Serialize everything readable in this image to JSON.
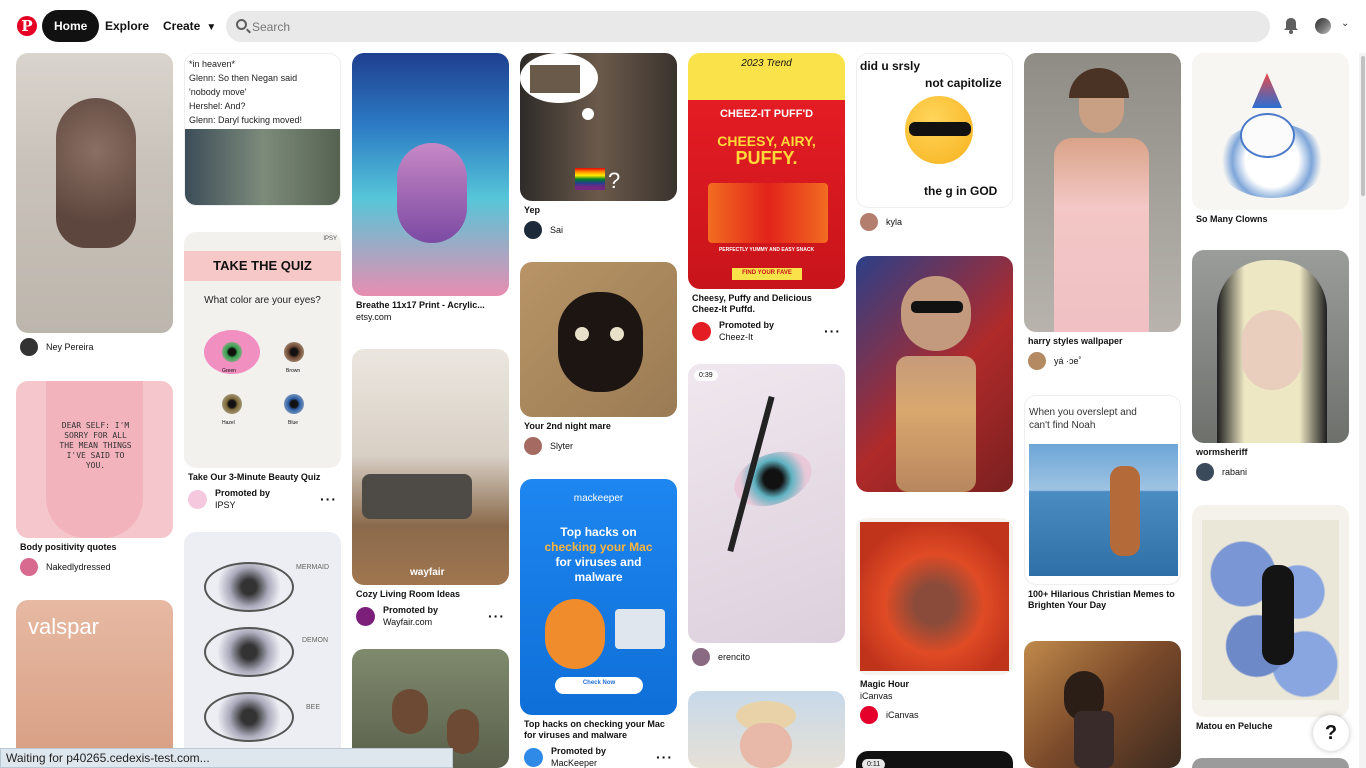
{
  "header": {
    "logo": "P",
    "nav": {
      "home": "Home",
      "explore": "Explore",
      "create": "Create"
    },
    "search": {
      "placeholder": "Search"
    }
  },
  "pins": [
    {
      "author": "Ney Pereira"
    },
    {
      "title": "Body positivity quotes",
      "author": "Nakedlydressed",
      "image_text": "DEAR SELF: I'M SORRY FOR ALL THE MEAN THINGS I'VE SAID TO YOU."
    },
    {
      "image_text": "valspar"
    },
    {
      "image_text": [
        "*in heaven*",
        "Glenn: So then Negan said",
        "'nobody move'",
        "Hershel: And?",
        "Glenn: Daryl fucking moved!"
      ]
    },
    {
      "title": "Take Our 3-Minute Beauty Quiz",
      "promoted": "Promoted by",
      "author": "IPSY",
      "image_text": {
        "brand": "IPSY",
        "banner": "TAKE THE QUIZ",
        "question": "What color are your eyes?",
        "eyes": [
          "Green",
          "Brown",
          "Hazel",
          "Blue"
        ]
      }
    },
    {
      "image_text": [
        "MERMAID",
        "DEMON",
        "BEE"
      ]
    },
    {
      "title": "Breathe 11x17 Print - Acrylic...",
      "subtitle": "etsy.com"
    },
    {
      "title": "Cozy Living Room Ideas",
      "promoted": "Promoted by",
      "author": "Wayfair.com",
      "image_text": "wayfair"
    },
    {},
    {
      "title": "Yep",
      "author": "Sai"
    },
    {
      "title": "Your 2nd night mare",
      "author": "Slyter"
    },
    {
      "title": "Top hacks on checking your Mac for viruses and malware",
      "promoted": "Promoted by",
      "author": "MacKeeper",
      "image_text": {
        "brand": "mackeeper",
        "line1": "Top hacks on",
        "line2": "checking your Mac",
        "line3": "for viruses and",
        "line4": "malware",
        "button": "Check Now"
      }
    },
    {
      "title": "Cheesy, Puffy and Delicious Cheez-It Puffd.",
      "promoted": "Promoted by",
      "author": "Cheez-It",
      "image_text": {
        "trend": "2023 Trend",
        "brand": "CHEEZ-IT PUFF'D",
        "line1": "CHEESY, AIRY,",
        "line2": "PUFFY.",
        "tag": "PERFECTLY YUMMY AND EASY SNACK",
        "button": "FIND YOUR FAVE"
      }
    },
    {
      "duration": "0:39",
      "author": "erencito"
    },
    {},
    {
      "author": "kyla",
      "image_text": [
        "did u srsly",
        "not capitolize",
        "the g in GOD"
      ]
    },
    {},
    {
      "title": "Magic Hour",
      "subtitle": "iCanvas",
      "author": "iCanvas"
    },
    {
      "duration": "0:11"
    },
    {
      "title": "harry styles wallpaper",
      "author": "yá ·ɔe˚"
    },
    {
      "title": "100+ Hilarious Christian Memes to Brighten Your Day",
      "image_text": [
        "When you overslept and",
        "can't find Noah"
      ]
    },
    {},
    {
      "title": "So Many Clowns"
    },
    {
      "title": "wormsheriff",
      "author": "rabani"
    },
    {
      "title": "Matou en Peluche"
    }
  ],
  "help": "?",
  "status_bar": "Waiting for p40265.cedexis-test.com..."
}
